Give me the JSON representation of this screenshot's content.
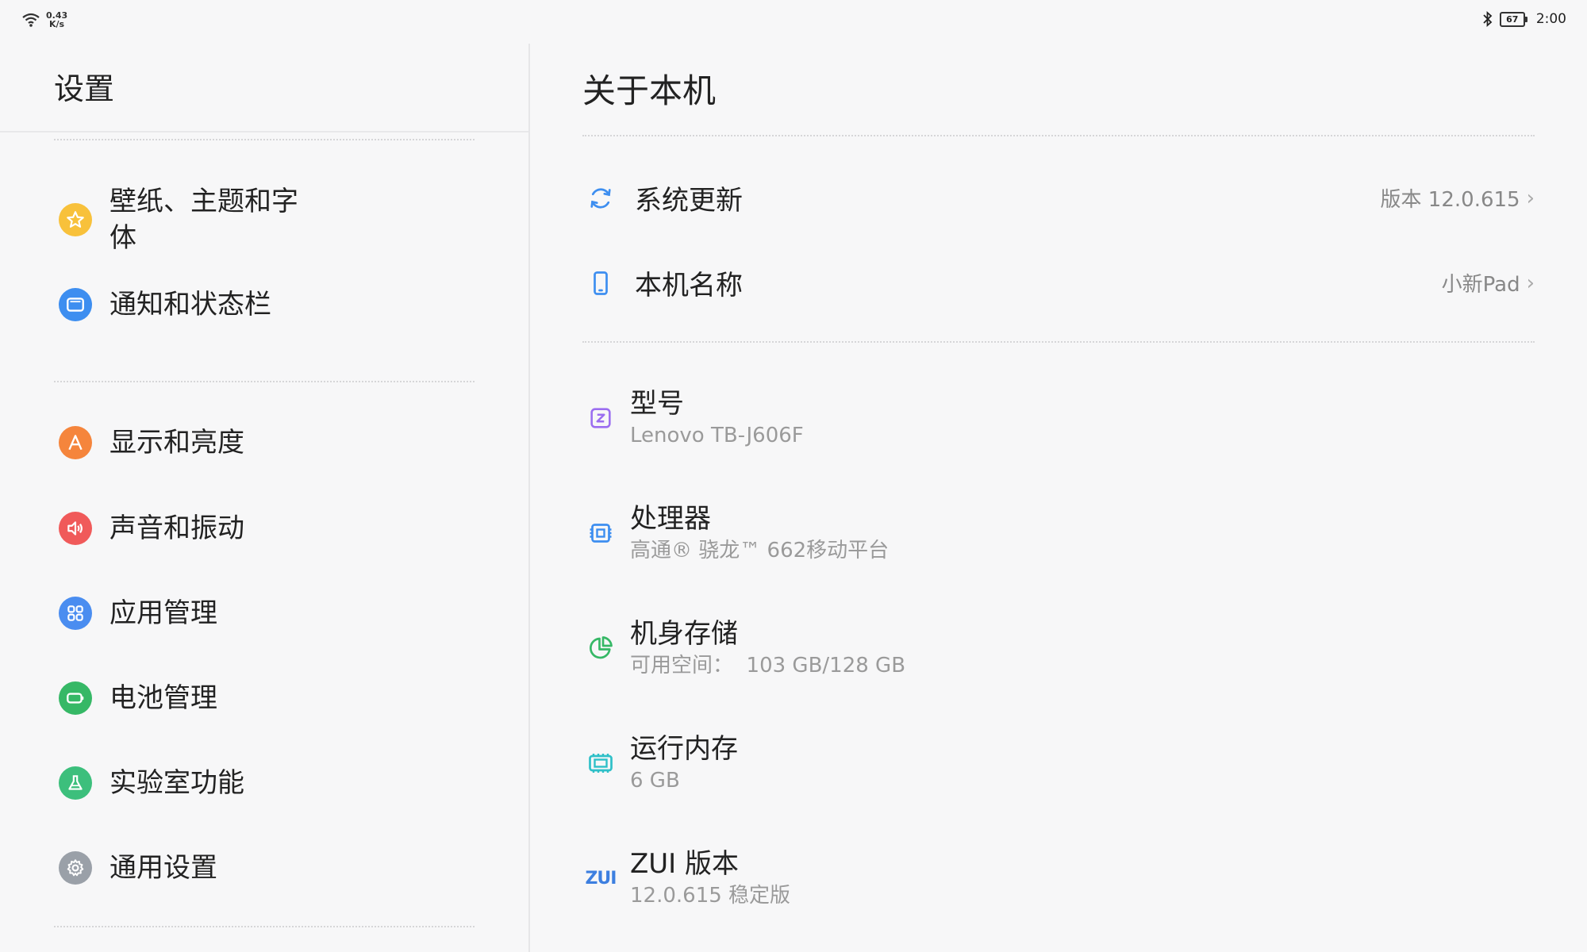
{
  "statusbar": {
    "net_speed_value": "0.43",
    "net_speed_unit": "K/s",
    "battery": "67",
    "time": "2:00"
  },
  "left": {
    "title": "设置",
    "items": [
      {
        "label": "壁纸、主题和字体",
        "icon": "star-icon",
        "color": "#f8c13b"
      },
      {
        "label": "通知和状态栏",
        "icon": "notification-icon",
        "color": "#3d8ef0"
      },
      {
        "label": "显示和亮度",
        "icon": "display-icon",
        "color": "#f5853c"
      },
      {
        "label": "声音和振动",
        "icon": "speaker-icon",
        "color": "#f05a5a"
      },
      {
        "label": "应用管理",
        "icon": "apps-grid-icon",
        "color": "#4a8df0"
      },
      {
        "label": "电池管理",
        "icon": "battery-icon",
        "color": "#36b866"
      },
      {
        "label": "实验室功能",
        "icon": "flask-icon",
        "color": "#3cbf7c"
      },
      {
        "label": "通用设置",
        "icon": "gear-icon",
        "color": "#9aa0a8"
      }
    ]
  },
  "right": {
    "title": "关于本机",
    "system_update": {
      "label": "系统更新",
      "value": "版本 12.0.615"
    },
    "device_name": {
      "label": "本机名称",
      "value": "小新Pad"
    },
    "model": {
      "label": "型号",
      "value": "Lenovo TB-J606F"
    },
    "processor": {
      "label": "处理器",
      "value": "高通® 骁龙™ 662移动平台"
    },
    "storage": {
      "label": "机身存储",
      "value": "可用空间：  103 GB/128 GB"
    },
    "ram": {
      "label": "运行内存",
      "value": "6 GB"
    },
    "zui": {
      "label": "ZUI 版本",
      "value": "12.0.615 稳定版",
      "logo_text": "ZUI"
    }
  }
}
